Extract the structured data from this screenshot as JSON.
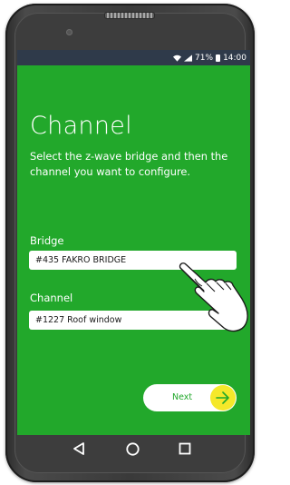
{
  "status_bar": {
    "battery_percent": "71%",
    "time": "14:00",
    "icons": [
      "wifi-icon",
      "signal-icon",
      "battery-icon"
    ]
  },
  "page": {
    "title": "Channel",
    "subtitle": "Select the z-wave bridge and then the channel you want to configure."
  },
  "bridge": {
    "label": "Bridge",
    "value": "#435 FAKRO BRIDGE"
  },
  "channel": {
    "label": "Channel",
    "value": "#1227 Roof window"
  },
  "next_button": {
    "label": "Next",
    "icon": "arrow-right-icon"
  },
  "navigation": {
    "icons": [
      "back-triangle-icon",
      "home-circle-icon",
      "recents-square-icon"
    ]
  },
  "colors": {
    "screen_background": "#22a82b",
    "status_bar": "#2f3a4a",
    "accent_yellow": "#f5e82a"
  }
}
